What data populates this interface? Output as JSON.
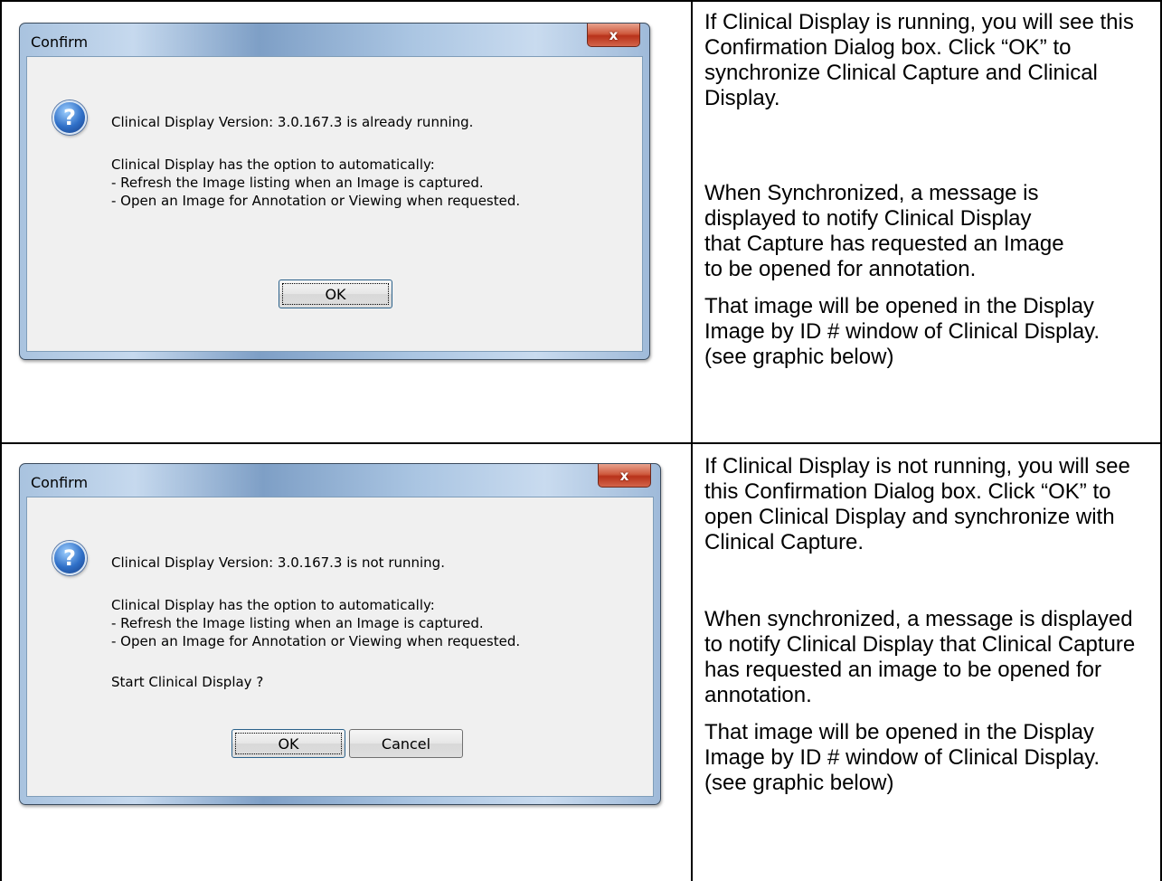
{
  "rows": [
    {
      "dialog": {
        "title": "Confirm",
        "close_glyph": "x",
        "icon": "question-icon",
        "message_lines": [
          "Clinical Display Version: 3.0.167.3 is already running.",
          "Clinical Display has the option to automatically:",
          "- Refresh the Image listing when an Image is captured.",
          "- Open an Image for Annotation or Viewing when requested."
        ],
        "ok_label": "OK"
      },
      "description": [
        "If Clinical Display is running, you will see this Confirmation Dialog box. Click “OK” to synchronize Clinical Capture and Clinical Display.",
        "When Synchronized, a message  is displayed  to notify Clinical Display that Capture has requested an Image to be opened for annotation.",
        "That image will be opened in the Display Image by ID # window of Clinical Display. (see graphic below)"
      ]
    },
    {
      "dialog": {
        "title": "Confirm",
        "close_glyph": "x",
        "icon": "question-icon",
        "message_lines": [
          "Clinical Display Version: 3.0.167.3 is not running.",
          "Clinical Display has the option to automatically:",
          "- Refresh the Image listing when an Image is captured.",
          "- Open an Image for Annotation or Viewing when requested.",
          "Start Clinical Display ?"
        ],
        "ok_label": "OK",
        "cancel_label": "Cancel"
      },
      "description": [
        "If Clinical Display is not running, you will see this Confirmation Dialog box. Click “OK” to open Clinical Display and synchronize with Clinical Capture.",
        "When synchronized, a message is displayed to notify Clinical Display that Clinical Capture has requested an image to be opened for annotation.",
        "That image will be opened in the Display Image by ID # window of Clinical Display. (see graphic below)"
      ]
    }
  ]
}
